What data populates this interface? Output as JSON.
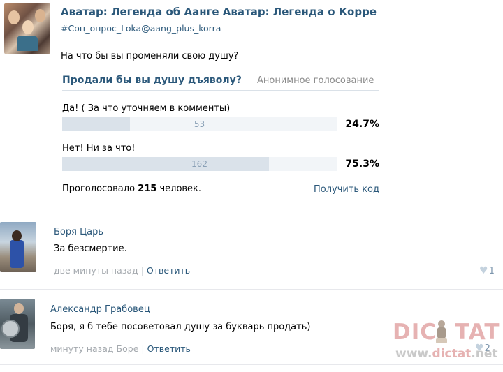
{
  "post": {
    "title": "Аватар: Легенда об Аанге Аватар: Легенда о Корре",
    "hashtag": "#Соц_опрос_Loka@aang_plus_korra",
    "text": "На что бы вы променяли свою душу?",
    "poll": {
      "question": "Продали бы вы душу дъяволу?",
      "type": "Анонимное голосование",
      "options": [
        {
          "label": "Да! ( За что уточняем в комменты)",
          "count": "53",
          "percent": "24.7%",
          "fraction": 0.247
        },
        {
          "label": "Нет! Ни за что!",
          "count": "162",
          "percent": "75.3%",
          "fraction": 0.753
        }
      ],
      "total_prefix": "Проголосовало",
      "total_count": "215",
      "total_suffix": "человек.",
      "get_code": "Получить код"
    }
  },
  "comments": [
    {
      "author": "Боря Царь",
      "text": "За безсмертие.",
      "time": "две минуты назад",
      "reply": "Ответить",
      "likes": "1",
      "like_icon": "heart-icon"
    },
    {
      "author": "Александр Грабовец",
      "text": "Боря, я б тебе посоветовал душу за букварь продать)",
      "time": "минуту назад Боре",
      "reply": "Ответить",
      "likes": "2",
      "like_icon": "heart-icon"
    }
  ],
  "watermark": {
    "logo_left": "DIC",
    "logo_right": "TAT",
    "url_prefix": "www.",
    "url_brand": "dictat",
    "url_suffix": ".net"
  },
  "colors": {
    "link": "#2b587a",
    "bar_fill": "#dae2ea",
    "watermark": "#e6b2b2"
  }
}
